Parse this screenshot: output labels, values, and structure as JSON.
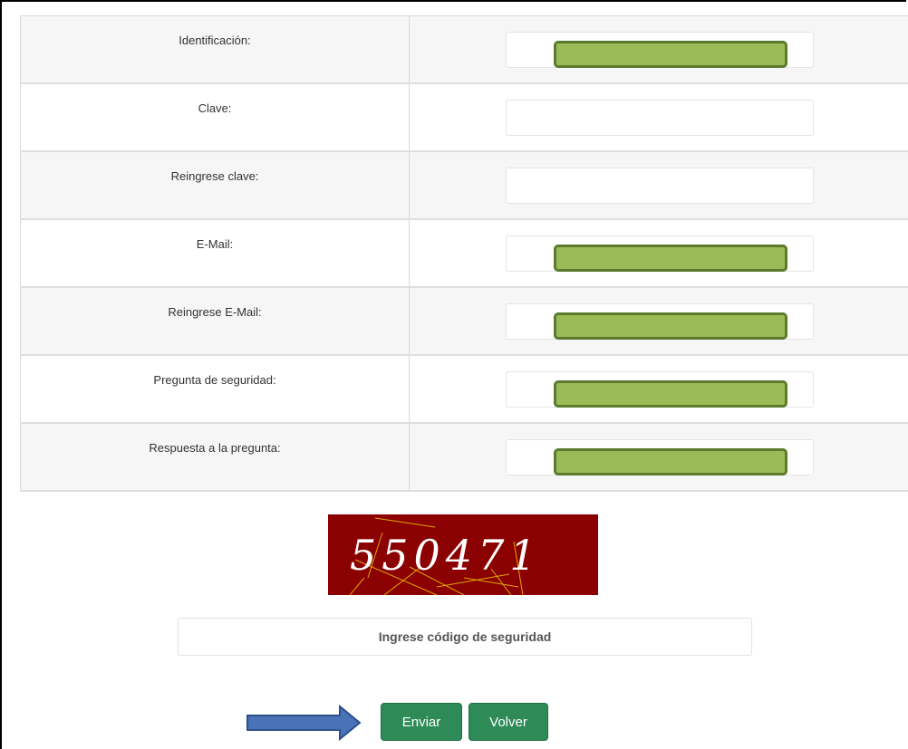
{
  "form": {
    "rows": [
      {
        "label": "Identificación:",
        "redacted": true
      },
      {
        "label": "Clave:",
        "redacted": false
      },
      {
        "label": "Reingrese clave:",
        "redacted": false
      },
      {
        "label": "E-Mail:",
        "redacted": true
      },
      {
        "label": "Reingrese E-Mail:",
        "redacted": true
      },
      {
        "label": "Pregunta de seguridad:",
        "redacted": true
      },
      {
        "label": "Respuesta a la pregunta:",
        "redacted": true
      }
    ]
  },
  "captcha": {
    "code": "550471"
  },
  "security_code": {
    "placeholder": "Ingrese código de seguridad"
  },
  "buttons": {
    "send": "Enviar",
    "back": "Volver"
  },
  "colors": {
    "button": "#2e8b57",
    "redaction_fill": "#9bbb59",
    "redaction_border": "#5b7a2b",
    "captcha_bg": "#8b0000",
    "arrow": "#4a72b8"
  }
}
